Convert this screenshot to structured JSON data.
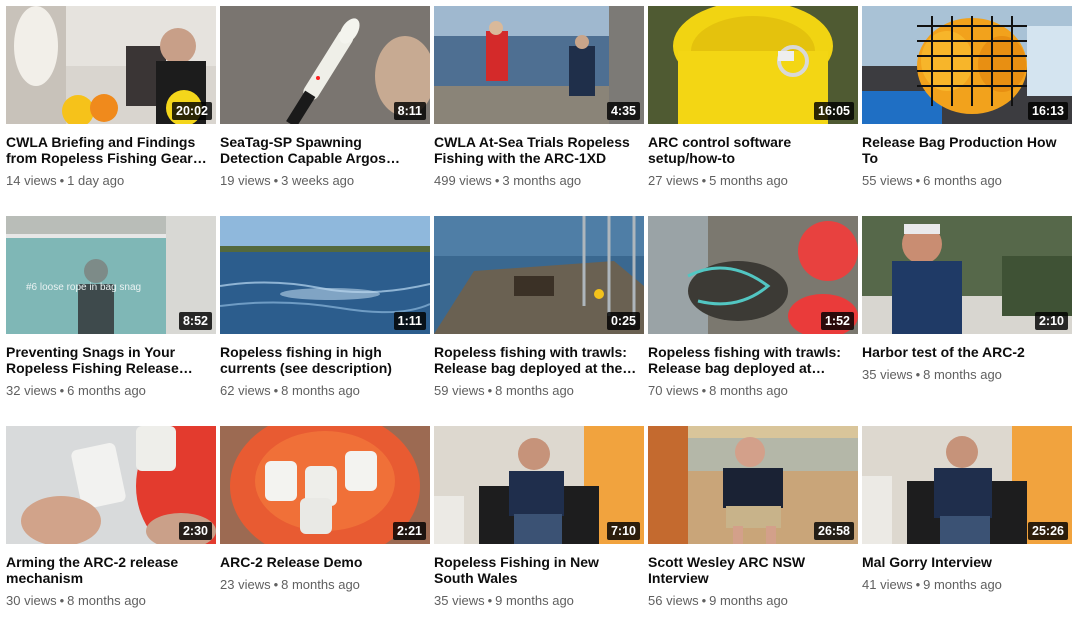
{
  "videos": [
    {
      "title": "CWLA Briefing and Findings from Ropeless Fishing Gear…",
      "views": "14 views",
      "age": "1 day ago",
      "duration": "20:02"
    },
    {
      "title": "SeaTag-SP Spawning Detection Capable Argos…",
      "views": "19 views",
      "age": "3 weeks ago",
      "duration": "8:11"
    },
    {
      "title": "CWLA At-Sea Trials Ropeless Fishing with the ARC-1XD",
      "views": "499 views",
      "age": "3 months ago",
      "duration": "4:35"
    },
    {
      "title": "ARC control software setup/how-to",
      "views": "27 views",
      "age": "5 months ago",
      "duration": "16:05"
    },
    {
      "title": "Release Bag Production How To",
      "views": "55 views",
      "age": "6 months ago",
      "duration": "16:13"
    },
    {
      "title": "Preventing Snags in Your Ropeless Fishing Release…",
      "views": "32 views",
      "age": "6 months ago",
      "duration": "8:52",
      "overlay_text": "#6 loose rope in bag snag"
    },
    {
      "title": "Ropeless fishing in high currents (see description)",
      "views": "62 views",
      "age": "8 months ago",
      "duration": "1:11"
    },
    {
      "title": "Ropeless fishing with trawls: Release bag deployed at the…",
      "views": "59 views",
      "age": "8 months ago",
      "duration": "0:25"
    },
    {
      "title": "Ropeless fishing with trawls: Release bag deployed at…",
      "views": "70 views",
      "age": "8 months ago",
      "duration": "1:52"
    },
    {
      "title": "Harbor test of the ARC-2",
      "views": "35 views",
      "age": "8 months ago",
      "duration": "2:10"
    },
    {
      "title": "Arming the ARC-2 release mechanism",
      "views": "30 views",
      "age": "8 months ago",
      "duration": "2:30"
    },
    {
      "title": "ARC-2 Release Demo",
      "views": "23 views",
      "age": "8 months ago",
      "duration": "2:21"
    },
    {
      "title": "Ropeless Fishing in New South Wales",
      "views": "35 views",
      "age": "9 months ago",
      "duration": "7:10"
    },
    {
      "title": "Scott Wesley ARC NSW Interview",
      "views": "56 views",
      "age": "9 months ago",
      "duration": "26:58"
    },
    {
      "title": "Mal Gorry Interview",
      "views": "41 views",
      "age": "9 months ago",
      "duration": "25:26"
    }
  ],
  "separator": "•"
}
